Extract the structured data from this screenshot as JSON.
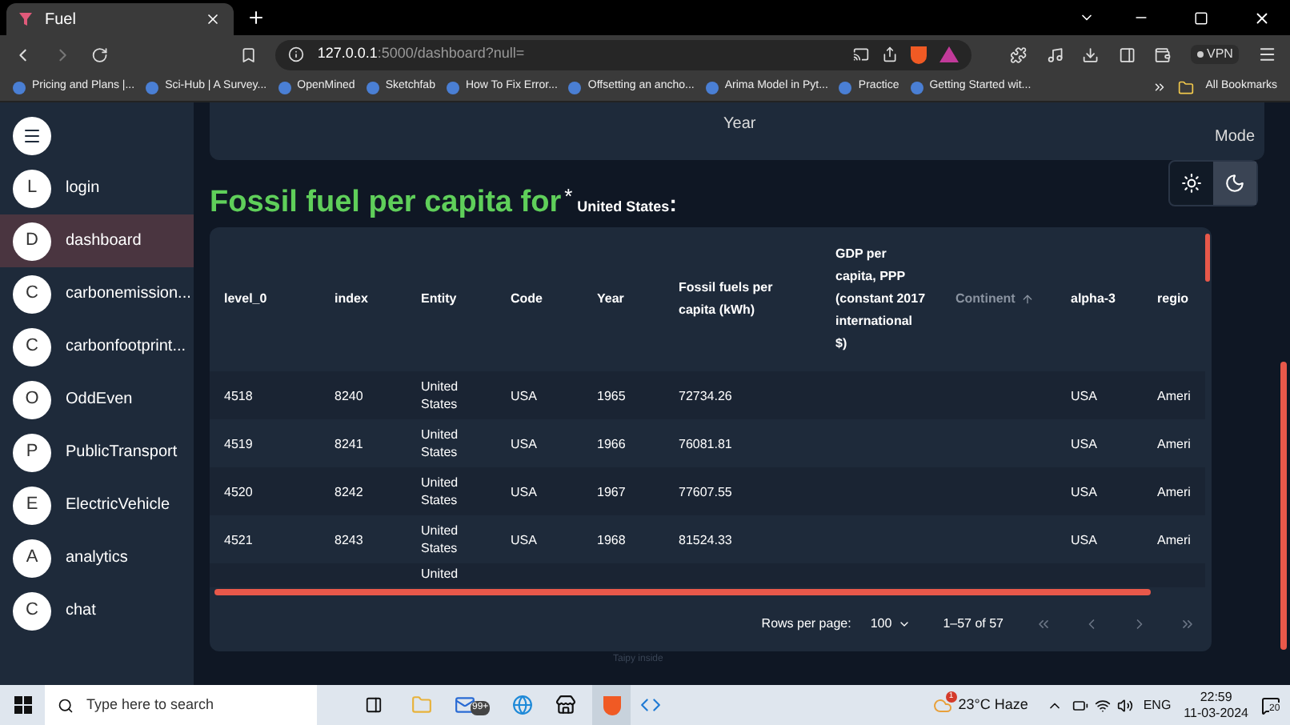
{
  "browser": {
    "tab": {
      "title": "Fuel"
    },
    "url": {
      "host": "127.0.0.1",
      "path": ":5000/dashboard?null="
    },
    "vpn": "VPN",
    "bookmarks": [
      {
        "label": "Pricing and Plans |..."
      },
      {
        "label": "Sci-Hub | A Survey..."
      },
      {
        "label": "OpenMined"
      },
      {
        "label": "Sketchfab"
      },
      {
        "label": "How To Fix Error..."
      },
      {
        "label": "Offsetting an ancho..."
      },
      {
        "label": "Arima Model in Pyt..."
      },
      {
        "label": "Practice"
      },
      {
        "label": "Getting Started wit..."
      }
    ],
    "all_bookmarks": "All Bookmarks"
  },
  "sidebar": {
    "items": [
      {
        "letter": "L",
        "label": "login",
        "selected": false
      },
      {
        "letter": "D",
        "label": "dashboard",
        "selected": true
      },
      {
        "letter": "C",
        "label": "carbonemission...",
        "selected": false
      },
      {
        "letter": "C",
        "label": "carbonfootprint...",
        "selected": false
      },
      {
        "letter": "O",
        "label": "OddEven",
        "selected": false
      },
      {
        "letter": "P",
        "label": "PublicTransport",
        "selected": false
      },
      {
        "letter": "E",
        "label": "ElectricVehicle",
        "selected": false
      },
      {
        "letter": "A",
        "label": "analytics",
        "selected": false
      },
      {
        "letter": "C",
        "label": "chat",
        "selected": false
      }
    ]
  },
  "top_card": {
    "label": "Year"
  },
  "mode": {
    "label": "Mode",
    "options": [
      {
        "kind": "light",
        "selected": false
      },
      {
        "kind": "dark",
        "selected": true
      }
    ]
  },
  "title": {
    "text": "Fossil fuel per capita for",
    "mark": "*",
    "country": "United States",
    "colon": ":"
  },
  "table": {
    "columns": [
      {
        "label": "level_0",
        "sorted": false
      },
      {
        "label": "index",
        "sorted": false
      },
      {
        "label": "Entity",
        "sorted": false
      },
      {
        "label": "Code",
        "sorted": false
      },
      {
        "label": "Year",
        "sorted": false
      },
      {
        "label": "Fossil fuels per capita (kWh)",
        "sorted": false
      },
      {
        "label": "GDP per capita, PPP (constant 2017 international $)",
        "sorted": false
      },
      {
        "label": "Continent",
        "sorted": true
      },
      {
        "label": "alpha-3",
        "sorted": false
      },
      {
        "label": "regio",
        "sorted": false
      }
    ],
    "rows": [
      [
        "4518",
        "8240",
        "United States",
        "USA",
        "1965",
        "72734.26",
        "",
        "",
        "USA",
        "Ameri"
      ],
      [
        "4519",
        "8241",
        "United States",
        "USA",
        "1966",
        "76081.81",
        "",
        "",
        "USA",
        "Ameri"
      ],
      [
        "4520",
        "8242",
        "United States",
        "USA",
        "1967",
        "77607.55",
        "",
        "",
        "USA",
        "Ameri"
      ],
      [
        "4521",
        "8243",
        "United States",
        "USA",
        "1968",
        "81524.33",
        "",
        "",
        "USA",
        "Ameri"
      ]
    ],
    "partial_row": {
      "entity": "United"
    },
    "pagination": {
      "rows_per_page_label": "Rows per page:",
      "rows_per_page": "100",
      "range": "1–57 of 57"
    }
  },
  "footer": "Taipy inside",
  "taskbar": {
    "search_placeholder": "Type here to search",
    "mail_badge": "99+",
    "weather_badge": "1",
    "weather": "23°C Haze",
    "language": "ENG",
    "time": "22:59",
    "date": "11-03-2024",
    "notifications": "20"
  }
}
